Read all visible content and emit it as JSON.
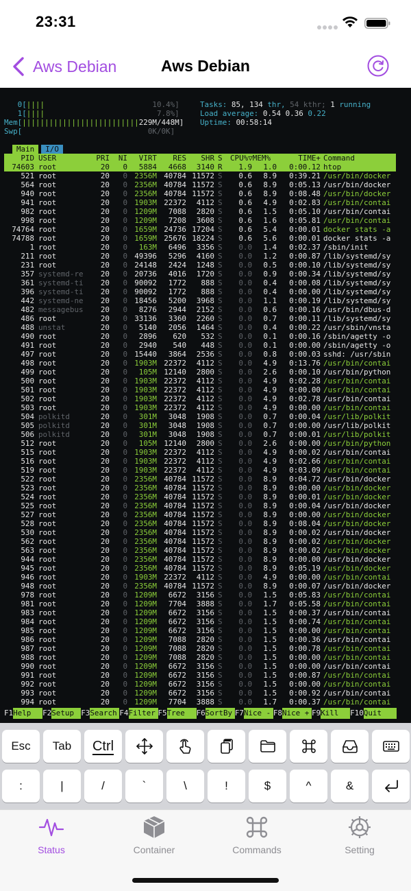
{
  "status_bar": {
    "time": "23:31"
  },
  "nav": {
    "back_label": "Aws Debian",
    "title": "Aws Debian"
  },
  "terminal": {
    "meters": {
      "cpu0_label": "0[",
      "cpu0_bar": "||||",
      "cpu0_pct": "10.4%]",
      "cpu1_label": "1[",
      "cpu1_bar": "||||",
      "cpu1_pct": "7.8%]",
      "mem_label": "Mem[",
      "mem_bar": "||||||||||||||||||||||||||",
      "mem_val": "229M/448M]",
      "swp_label": "Swp[",
      "swp_val": "0K/0K]",
      "tasks_label": "Tasks:",
      "tasks_val": "85,",
      "thr_val": "134",
      "thr_label": "thr,",
      "kthr_val": "54 kthr;",
      "running_val": "1",
      "running_label": "running",
      "load_label": "Load average:",
      "load1": "0.54",
      "load5": "0.36",
      "load15": "0.22",
      "uptime_label": "Uptime:",
      "uptime_val": "00:58:14"
    },
    "tabs": [
      "Main",
      "I/O"
    ],
    "columns": [
      "PID",
      "USER",
      "PRI",
      "NI",
      "VIRT",
      "RES",
      "SHR",
      "S",
      "CPU%▽MEM%",
      "TIME+",
      "Command"
    ],
    "selected": [
      "74603",
      "root",
      "20",
      "0",
      "5884",
      "4668",
      "3140",
      "R",
      "1.9",
      "1.0",
      "0:00.12",
      "htop"
    ],
    "rows": [
      [
        "521",
        "root",
        "20",
        "0",
        "2356M",
        "40784",
        "11572",
        "S",
        "0.6",
        "8.9",
        "0:39.21",
        "/usr/bin/docker"
      ],
      [
        "564",
        "root",
        "20",
        "0",
        "2356M",
        "40784",
        "11572",
        "S",
        "0.6",
        "8.9",
        "0:05.13",
        "/usr/bin/docker"
      ],
      [
        "940",
        "root",
        "20",
        "0",
        "2356M",
        "40784",
        "11572",
        "S",
        "0.6",
        "8.9",
        "0:08.48",
        "/usr/bin/docker"
      ],
      [
        "941",
        "root",
        "20",
        "0",
        "1903M",
        "22372",
        "4112",
        "S",
        "0.6",
        "4.9",
        "0:02.83",
        "/usr/bin/contai"
      ],
      [
        "982",
        "root",
        "20",
        "0",
        "1209M",
        "7088",
        "2820",
        "S",
        "0.6",
        "1.5",
        "0:05.10",
        "/usr/bin/contai"
      ],
      [
        "998",
        "root",
        "20",
        "0",
        "1209M",
        "7208",
        "3608",
        "S",
        "0.6",
        "1.6",
        "0:05.81",
        "/usr/bin/contai"
      ],
      [
        "74764",
        "root",
        "20",
        "0",
        "1659M",
        "24736",
        "17204",
        "S",
        "0.6",
        "5.4",
        "0:00.01",
        "docker stats -a"
      ],
      [
        "74788",
        "root",
        "20",
        "0",
        "1659M",
        "25676",
        "18224",
        "S",
        "0.6",
        "5.6",
        "0:00.01",
        "docker stats -a"
      ],
      [
        "1",
        "root",
        "20",
        "0",
        "163M",
        "6496",
        "3356",
        "S",
        "0.0",
        "1.4",
        "0:02.37",
        "/sbin/init"
      ],
      [
        "211",
        "root",
        "20",
        "0",
        "49396",
        "5296",
        "4160",
        "S",
        "0.0",
        "1.2",
        "0:00.87",
        "/lib/systemd/sy"
      ],
      [
        "231",
        "root",
        "20",
        "0",
        "24148",
        "2424",
        "1248",
        "S",
        "0.0",
        "0.5",
        "0:00.10",
        "/lib/systemd/sy"
      ],
      [
        "357",
        "systemd-re",
        "20",
        "0",
        "20736",
        "4016",
        "1720",
        "S",
        "0.0",
        "0.9",
        "0:00.34",
        "/lib/systemd/sy"
      ],
      [
        "361",
        "systemd-ti",
        "20",
        "0",
        "90092",
        "1772",
        "888",
        "S",
        "0.0",
        "0.4",
        "0:00.08",
        "/lib/systemd/sy"
      ],
      [
        "396",
        "systemd-ti",
        "20",
        "0",
        "90092",
        "1772",
        "888",
        "S",
        "0.0",
        "0.4",
        "0:00.00",
        "/lib/systemd/sy"
      ],
      [
        "442",
        "systemd-ne",
        "20",
        "0",
        "18456",
        "5200",
        "3968",
        "S",
        "0.0",
        "1.1",
        "0:00.19",
        "/lib/systemd/sy"
      ],
      [
        "482",
        "messagebus",
        "20",
        "0",
        "8276",
        "2944",
        "2152",
        "S",
        "0.0",
        "0.6",
        "0:00.16",
        "/usr/bin/dbus-d"
      ],
      [
        "486",
        "root",
        "20",
        "0",
        "33136",
        "3360",
        "2260",
        "S",
        "0.0",
        "0.7",
        "0:00.11",
        "/lib/systemd/sy"
      ],
      [
        "488",
        "unstat",
        "20",
        "0",
        "5140",
        "2056",
        "1464",
        "S",
        "0.0",
        "0.4",
        "0:00.22",
        "/usr/sbin/vnsta"
      ],
      [
        "490",
        "root",
        "20",
        "0",
        "2896",
        "620",
        "532",
        "S",
        "0.0",
        "0.1",
        "0:00.16",
        "/sbin/agetty -o"
      ],
      [
        "491",
        "root",
        "20",
        "0",
        "2940",
        "540",
        "448",
        "S",
        "0.0",
        "0.1",
        "0:00.00",
        "/sbin/agetty -o"
      ],
      [
        "497",
        "root",
        "20",
        "0",
        "15440",
        "3864",
        "2536",
        "S",
        "0.0",
        "0.8",
        "0:00.03",
        "sshd: /usr/sbin"
      ],
      [
        "498",
        "root",
        "20",
        "0",
        "1903M",
        "22372",
        "4112",
        "S",
        "0.0",
        "4.9",
        "0:13.76",
        "/usr/bin/contai"
      ],
      [
        "499",
        "root",
        "20",
        "0",
        "105M",
        "12140",
        "2800",
        "S",
        "0.0",
        "2.6",
        "0:00.10",
        "/usr/bin/python"
      ],
      [
        "500",
        "root",
        "20",
        "0",
        "1903M",
        "22372",
        "4112",
        "S",
        "0.0",
        "4.9",
        "0:02.28",
        "/usr/bin/contai"
      ],
      [
        "501",
        "root",
        "20",
        "0",
        "1903M",
        "22372",
        "4112",
        "S",
        "0.0",
        "4.9",
        "0:00.00",
        "/usr/bin/contai"
      ],
      [
        "502",
        "root",
        "20",
        "0",
        "1903M",
        "22372",
        "4112",
        "S",
        "0.0",
        "4.9",
        "0:02.78",
        "/usr/bin/contai"
      ],
      [
        "503",
        "root",
        "20",
        "0",
        "1903M",
        "22372",
        "4112",
        "S",
        "0.0",
        "4.9",
        "0:00.00",
        "/usr/bin/contai"
      ],
      [
        "504",
        "polkitd",
        "20",
        "0",
        "301M",
        "3048",
        "1908",
        "S",
        "0.0",
        "0.7",
        "0:00.04",
        "/usr/lib/polkit"
      ],
      [
        "505",
        "polkitd",
        "20",
        "0",
        "301M",
        "3048",
        "1908",
        "S",
        "0.0",
        "0.7",
        "0:00.00",
        "/usr/lib/polkit"
      ],
      [
        "506",
        "polkitd",
        "20",
        "0",
        "301M",
        "3048",
        "1908",
        "S",
        "0.0",
        "0.7",
        "0:00.01",
        "/usr/lib/polkit"
      ],
      [
        "512",
        "root",
        "20",
        "0",
        "105M",
        "12140",
        "2800",
        "S",
        "0.0",
        "2.6",
        "0:00.00",
        "/usr/bin/python"
      ],
      [
        "515",
        "root",
        "20",
        "0",
        "1903M",
        "22372",
        "4112",
        "S",
        "0.0",
        "4.9",
        "0:00.02",
        "/usr/bin/contai"
      ],
      [
        "516",
        "root",
        "20",
        "0",
        "1903M",
        "22372",
        "4112",
        "S",
        "0.0",
        "4.9",
        "0:02.66",
        "/usr/bin/contai"
      ],
      [
        "519",
        "root",
        "20",
        "0",
        "1903M",
        "22372",
        "4112",
        "S",
        "0.0",
        "4.9",
        "0:03.09",
        "/usr/bin/contai"
      ],
      [
        "522",
        "root",
        "20",
        "0",
        "2356M",
        "40784",
        "11572",
        "S",
        "0.0",
        "8.9",
        "0:04.72",
        "/usr/bin/docker"
      ],
      [
        "523",
        "root",
        "20",
        "0",
        "2356M",
        "40784",
        "11572",
        "S",
        "0.0",
        "8.9",
        "0:00.00",
        "/usr/bin/docker"
      ],
      [
        "524",
        "root",
        "20",
        "0",
        "2356M",
        "40784",
        "11572",
        "S",
        "0.0",
        "8.9",
        "0:00.01",
        "/usr/bin/docker"
      ],
      [
        "525",
        "root",
        "20",
        "0",
        "2356M",
        "40784",
        "11572",
        "S",
        "0.0",
        "8.9",
        "0:00.04",
        "/usr/bin/docker"
      ],
      [
        "527",
        "root",
        "20",
        "0",
        "2356M",
        "40784",
        "11572",
        "S",
        "0.0",
        "8.9",
        "0:00.00",
        "/usr/bin/docker"
      ],
      [
        "528",
        "root",
        "20",
        "0",
        "2356M",
        "40784",
        "11572",
        "S",
        "0.0",
        "8.9",
        "0:08.04",
        "/usr/bin/docker"
      ],
      [
        "530",
        "root",
        "20",
        "0",
        "2356M",
        "40784",
        "11572",
        "S",
        "0.0",
        "8.9",
        "0:00.02",
        "/usr/bin/docker"
      ],
      [
        "562",
        "root",
        "20",
        "0",
        "2356M",
        "40784",
        "11572",
        "S",
        "0.0",
        "8.9",
        "0:00.02",
        "/usr/bin/docker"
      ],
      [
        "563",
        "root",
        "20",
        "0",
        "2356M",
        "40784",
        "11572",
        "S",
        "0.0",
        "8.9",
        "0:00.02",
        "/usr/bin/docker"
      ],
      [
        "944",
        "root",
        "20",
        "0",
        "2356M",
        "40784",
        "11572",
        "S",
        "0.0",
        "8.9",
        "0:00.00",
        "/usr/bin/docker"
      ],
      [
        "945",
        "root",
        "20",
        "0",
        "2356M",
        "40784",
        "11572",
        "S",
        "0.0",
        "8.9",
        "0:05.19",
        "/usr/bin/docker"
      ],
      [
        "946",
        "root",
        "20",
        "0",
        "1903M",
        "22372",
        "4112",
        "S",
        "0.0",
        "4.9",
        "0:00.00",
        "/usr/bin/contai"
      ],
      [
        "948",
        "root",
        "20",
        "0",
        "2356M",
        "40784",
        "11572",
        "S",
        "0.0",
        "8.9",
        "0:00.07",
        "/usr/bin/docker"
      ],
      [
        "978",
        "root",
        "20",
        "0",
        "1209M",
        "6672",
        "3156",
        "S",
        "0.0",
        "1.5",
        "0:05.83",
        "/usr/bin/contai"
      ],
      [
        "981",
        "root",
        "20",
        "0",
        "1209M",
        "7704",
        "3888",
        "S",
        "0.0",
        "1.7",
        "0:05.58",
        "/usr/bin/contai"
      ],
      [
        "983",
        "root",
        "20",
        "0",
        "1209M",
        "6672",
        "3156",
        "S",
        "0.0",
        "1.5",
        "0:00.37",
        "/usr/bin/contai"
      ],
      [
        "984",
        "root",
        "20",
        "0",
        "1209M",
        "6672",
        "3156",
        "S",
        "0.0",
        "1.5",
        "0:00.74",
        "/usr/bin/contai"
      ],
      [
        "985",
        "root",
        "20",
        "0",
        "1209M",
        "6672",
        "3156",
        "S",
        "0.0",
        "1.5",
        "0:00.00",
        "/usr/bin/contai"
      ],
      [
        "986",
        "root",
        "20",
        "0",
        "1209M",
        "7088",
        "2820",
        "S",
        "0.0",
        "1.5",
        "0:00.36",
        "/usr/bin/contai"
      ],
      [
        "987",
        "root",
        "20",
        "0",
        "1209M",
        "7088",
        "2820",
        "S",
        "0.0",
        "1.5",
        "0:00.78",
        "/usr/bin/contai"
      ],
      [
        "988",
        "root",
        "20",
        "0",
        "1209M",
        "7088",
        "2820",
        "S",
        "0.0",
        "1.5",
        "0:00.00",
        "/usr/bin/contai"
      ],
      [
        "990",
        "root",
        "20",
        "0",
        "1209M",
        "6672",
        "3156",
        "S",
        "0.0",
        "1.5",
        "0:00.00",
        "/usr/bin/contai"
      ],
      [
        "991",
        "root",
        "20",
        "0",
        "1209M",
        "6672",
        "3156",
        "S",
        "0.0",
        "1.5",
        "0:00.87",
        "/usr/bin/contai"
      ],
      [
        "992",
        "root",
        "20",
        "0",
        "1209M",
        "6672",
        "3156",
        "S",
        "0.0",
        "1.5",
        "0:00.00",
        "/usr/bin/contai"
      ],
      [
        "993",
        "root",
        "20",
        "0",
        "1209M",
        "6672",
        "3156",
        "S",
        "0.0",
        "1.5",
        "0:00.92",
        "/usr/bin/contai"
      ],
      [
        "994",
        "root",
        "20",
        "0",
        "1209M",
        "7704",
        "3888",
        "S",
        "0.0",
        "1.7",
        "0:00.37",
        "/usr/bin/contai"
      ]
    ],
    "function_keys": [
      {
        "key": "F1",
        "label": "Help"
      },
      {
        "key": "F2",
        "label": "Setup"
      },
      {
        "key": "F3",
        "label": "Search"
      },
      {
        "key": "F4",
        "label": "Filter"
      },
      {
        "key": "F5",
        "label": "Tree  "
      },
      {
        "key": "F6",
        "label": "SortBy"
      },
      {
        "key": "F7",
        "label": "Nice -"
      },
      {
        "key": "F8",
        "label": "Nice +"
      },
      {
        "key": "F9",
        "label": "Kill  "
      },
      {
        "key": "F10",
        "label": "Quit  "
      }
    ]
  },
  "keyboard": {
    "row1": [
      "Esc",
      "Tab",
      "Ctrl"
    ],
    "row1_icons": [
      "move-arrows-icon",
      "touch-icon",
      "clipboard-icon",
      "folder-icon",
      "command-icon",
      "inbox-icon",
      "keyboard-icon"
    ],
    "row2": [
      ":",
      "|",
      "/",
      "`",
      "\\",
      "!",
      "$",
      "^",
      "&"
    ],
    "row2_icon": "return-icon"
  },
  "tabbar": {
    "items": [
      {
        "label": "Status",
        "icon": "waveform-icon"
      },
      {
        "label": "Container",
        "icon": "cube-icon"
      },
      {
        "label": "Commands",
        "icon": "command-icon"
      },
      {
        "label": "Setting",
        "icon": "gear-icon"
      }
    ],
    "active": "Status"
  },
  "colors": {
    "accent": "#a24de0",
    "terminal_bg": "#0c0e10",
    "htop_green": "#8ccf3a",
    "htop_cyan": "#46b0c8"
  }
}
